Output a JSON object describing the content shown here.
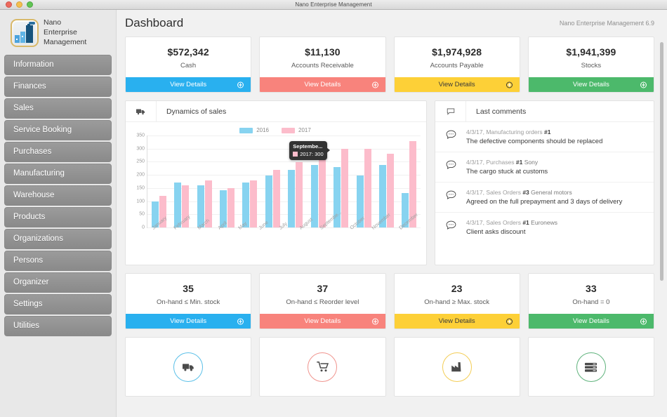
{
  "window": {
    "title": "Nano Enterprise Management",
    "controls": [
      "close",
      "minimize",
      "zoom"
    ]
  },
  "sidebar": {
    "brand": {
      "line1": "Nano",
      "line2": "Enterprise",
      "line3": "Management",
      "logo_icon": "factory-logo-icon"
    },
    "items": [
      {
        "label": "Information"
      },
      {
        "label": "Finances"
      },
      {
        "label": "Sales"
      },
      {
        "label": "Service Booking"
      },
      {
        "label": "Purchases"
      },
      {
        "label": "Manufacturing"
      },
      {
        "label": "Warehouse"
      },
      {
        "label": "Products"
      },
      {
        "label": "Organizations"
      },
      {
        "label": "Persons"
      },
      {
        "label": "Organizer"
      },
      {
        "label": "Settings"
      },
      {
        "label": "Utilities"
      }
    ]
  },
  "header": {
    "page_title": "Dashboard",
    "version": "Nano Enterprise Management 6.9"
  },
  "kpi_row_1": [
    {
      "value": "$572,342",
      "label": "Cash",
      "button": "View Details",
      "color": "#29b0ef"
    },
    {
      "value": "$11,130",
      "label": "Accounts Receivable",
      "button": "View Details",
      "color": "#f8837c"
    },
    {
      "value": "$1,974,928",
      "label": "Accounts Payable",
      "button": "View Details",
      "color": "#fdd037"
    },
    {
      "value": "$1,941,399",
      "label": "Stocks",
      "button": "View Details",
      "color": "#4cb96b"
    }
  ],
  "kpi_row_2": [
    {
      "value": "35",
      "label": "On-hand ≤ Min. stock",
      "button": "View Details",
      "color": "#29b0ef"
    },
    {
      "value": "37",
      "label": "On-hand ≤ Reorder level",
      "button": "View Details",
      "color": "#f8837c"
    },
    {
      "value": "23",
      "label": "On-hand ≥ Max. stock",
      "button": "View Details",
      "color": "#fdd037"
    },
    {
      "value": "33",
      "label": "On-hand = 0",
      "button": "View Details",
      "color": "#4cb96b"
    }
  ],
  "chart_panel": {
    "title": "Dynamics of sales",
    "icon": "truck-icon"
  },
  "comments_panel": {
    "title": "Last comments",
    "icon": "comment-icon",
    "items": [
      {
        "date": "4/3/17, ",
        "doc": "Manufacturing orders ",
        "num": "#1",
        "entity": "",
        "text": "The defective components should be replaced"
      },
      {
        "date": "4/3/17, ",
        "doc": "Purchases ",
        "num": "#1",
        "entity": " Sony",
        "text": "The cargo stuck at customs"
      },
      {
        "date": "4/3/17, ",
        "doc": "Sales Orders ",
        "num": "#3",
        "entity": " General motors",
        "text": "Agreed on the full prepayment and 3 days of delivery"
      },
      {
        "date": "4/3/17, ",
        "doc": "Sales Orders ",
        "num": "#1",
        "entity": " Euronews",
        "text": "Client asks discount"
      }
    ]
  },
  "icon_cards": [
    {
      "icon": "truck-icon",
      "color": "#5bc0e8"
    },
    {
      "icon": "cart-icon",
      "color": "#f0948e"
    },
    {
      "icon": "factory-icon",
      "color": "#f3cd55"
    },
    {
      "icon": "server-icon",
      "color": "#5fb37c"
    }
  ],
  "chart_data": {
    "type": "bar",
    "title": "Dynamics of sales",
    "xlabel": "",
    "ylabel": "",
    "ylim": [
      0,
      350
    ],
    "yticks": [
      0,
      50,
      100,
      150,
      200,
      250,
      300,
      350
    ],
    "grid": true,
    "legend_position": "top-center",
    "categories": [
      "January",
      "February",
      "March",
      "April",
      "May",
      "June",
      "July",
      "August",
      "Septembe...",
      "October",
      "November",
      "December"
    ],
    "series": [
      {
        "name": "2016",
        "color": "#87d3f0",
        "values": [
          100,
          170,
          160,
          141,
          170,
          199,
          218,
          239,
          229,
          199,
          239,
          130
        ]
      },
      {
        "name": "2017",
        "color": "#fcbccb",
        "values": [
          120,
          160,
          180,
          150,
          180,
          219,
          249,
          300,
          300,
          300,
          280,
          330
        ]
      }
    ],
    "tooltip": {
      "title": "Septembe...",
      "series": "2017",
      "value": "300",
      "label": "2017: 300",
      "swatch_color": "#fcbccb"
    }
  }
}
